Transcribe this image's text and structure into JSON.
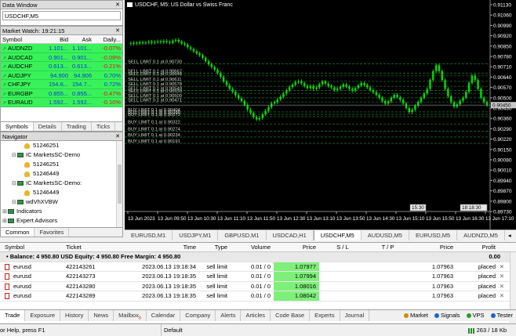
{
  "data_window": {
    "title": "Data Window",
    "symbol": "USDCHF,M5"
  },
  "market_watch": {
    "title": "Market Watch: 19:21:15",
    "headers": {
      "symbol": "Symbol",
      "bid": "Bid",
      "ask": "Ask",
      "daily": "Daily..."
    },
    "rows": [
      {
        "symbol": "AUDNZD",
        "bid": "1.101...",
        "ask": "1.101...",
        "daily": "-0.07%",
        "neg": true
      },
      {
        "symbol": "AUDCAD",
        "bid": "0.901...",
        "ask": "0.901...",
        "daily": "-0.09%",
        "neg": true
      },
      {
        "symbol": "AUDCHF",
        "bid": "0.613...",
        "ask": "0.613...",
        "daily": "-0.21%",
        "neg": true
      },
      {
        "symbol": "AUDJPY",
        "bid": "94.900",
        "ask": "94.906",
        "daily": "0.70%",
        "neg": false
      },
      {
        "symbol": "CHFJPY",
        "bid": "154.6...",
        "ask": "154.7...",
        "daily": "0.72%",
        "neg": false
      },
      {
        "symbol": "EURGBP",
        "bid": "0.855...",
        "ask": "0.855...",
        "daily": "-0.47%",
        "neg": true
      },
      {
        "symbol": "EURAUD",
        "bid": "1.592...",
        "ask": "1.592...",
        "daily": "-0.10%",
        "neg": true
      }
    ],
    "tabs": [
      "Symbols",
      "Details",
      "Trading",
      "Ticks"
    ]
  },
  "navigator": {
    "title": "Navigator",
    "items": [
      {
        "kind": "user",
        "label": "51246251",
        "indent": 30
      },
      {
        "kind": "server",
        "label": "IC MarketsSC-Demo",
        "indent": 14
      },
      {
        "kind": "user",
        "label": "51246251",
        "indent": 30
      },
      {
        "kind": "user",
        "label": "51246449",
        "indent": 30
      },
      {
        "kind": "server",
        "label": "IC MarketsSC-Demo:",
        "indent": 14
      },
      {
        "kind": "user",
        "label": "51246449",
        "indent": 30
      },
      {
        "kind": "server",
        "label": "wdVhXVBW",
        "indent": 14
      },
      {
        "kind": "folder",
        "label": "Indicators",
        "indent": 2
      },
      {
        "kind": "folder",
        "label": "Expert Advisors",
        "indent": 2
      }
    ],
    "tabs": [
      "Common",
      "Favorites"
    ]
  },
  "chart": {
    "title": "USDCHF, M5:  US Dollar vs Swiss Franc",
    "price_labels": [
      "0.91130",
      "0.91060",
      "0.90990",
      "0.90920",
      "0.90850",
      "0.90780",
      "0.90710",
      "0.90640",
      "0.90570",
      "0.90500",
      "0.90430",
      "0.90360",
      "0.90290",
      "0.90220",
      "0.90150",
      "0.90080",
      "0.90010",
      "0.89940",
      "0.89870",
      "0.89800",
      "0.89730"
    ],
    "current_price": "0.90450",
    "time_labels": [
      "13 Jun 2023",
      "13 Jun 09:50",
      "13 Jun 10:30",
      "13 Jun 11:10",
      "13 Jun 11:50",
      "13 Jun 12:30",
      "13 Jun 13:10",
      "13 Jun 13:50",
      "13 Jun 14:30",
      "13 Jun 15:10",
      "13 Jun 15:50",
      "13 Jun 16:30",
      "13 Jun 17:10"
    ],
    "time_boxes": [
      "15:30",
      "18:18:30"
    ],
    "orders": [
      "SELL LIMIT 0.1 at 0.90730",
      "SELL LIMIT 0.1 at 0.90667",
      "SELL LIMIT 0.1 at 0.90648",
      "SELL LIMIT 0.1 at 0.90611",
      "SELL LIMIT 0.1 at 0.90578",
      "SELL LIMIT 0.1 at 0.90549",
      "SELL LIMIT 0.1 at 0.90530",
      "SELL LIMIT 0.1 at 0.90500",
      "SELL LIMIT 0.1 at 0.90471",
      "BUY LIMIT 0.1 at 0.90404",
      "BUY LIMIT 0.1 at 0.90388",
      "BUY LIMIT 0.1 at 0.90372",
      "BUY LIMIT 0.1 at 0.90322",
      "BUY LIMIT 0.1 at 0.90274",
      "BUY LIMIT 0.1 at 0.90234",
      "BUY LIMIT 0.1 at 0.90191"
    ],
    "tabs": [
      "EURUSD,M1",
      "USDJPY,M1",
      "GBPUSD,M1",
      "USDCAD,H1",
      "USDCHF,M5",
      "AUDUSD,M5",
      "EURUSD,M5",
      "AUDNZD,M5"
    ],
    "active_tab": 4
  },
  "terminal": {
    "headers": [
      "Symbol",
      "Ticket",
      "Time",
      "Type",
      "Volume",
      "Price",
      "S / L",
      "T / P",
      "Price",
      "Profit"
    ],
    "balance": "Balance: 4 950.80 USD  Equity: 4 950.80  Free Margin: 4 950.80",
    "balance_profit": "0.00",
    "rows": [
      {
        "symbol": "eurusd",
        "ticket": "422143261",
        "time": "2023.06.13 19:18:34",
        "type": "sell limit",
        "volume": "0.01 / 0",
        "price": "1.07977",
        "sl": "",
        "tp": "",
        "cur": "1.07963",
        "state": "placed"
      },
      {
        "symbol": "eurusd",
        "ticket": "422143273",
        "time": "2023.06.13 19:18:35",
        "type": "sell limit",
        "volume": "0.01 / 0",
        "price": "1.07994",
        "sl": "",
        "tp": "",
        "cur": "1.07963",
        "state": "placed"
      },
      {
        "symbol": "eurusd",
        "ticket": "422143280",
        "time": "2023.06.13 19:18:35",
        "type": "sell limit",
        "volume": "0.01 / 0",
        "price": "1.08016",
        "sl": "",
        "tp": "",
        "cur": "1.07963",
        "state": "placed"
      },
      {
        "symbol": "eurusd",
        "ticket": "422143289",
        "time": "2023.06.13 19:18:35",
        "type": "sell limit",
        "volume": "0.01 / 0",
        "price": "1.08042",
        "sl": "",
        "tp": "",
        "cur": "1.07963",
        "state": "placed"
      }
    ],
    "tabs": [
      "Trade",
      "Exposure",
      "History",
      "News",
      "Mailbox",
      "Calendar",
      "Company",
      "Alerts",
      "Articles",
      "Code Base",
      "Experts",
      "Journal"
    ],
    "mailbox_badge": "8",
    "right_tools": [
      "Market",
      "Signals",
      "VPS",
      "Tester"
    ]
  },
  "status": {
    "help": "or Help, press F1",
    "profile": "Default",
    "traffic": "263 / 18 Kb"
  },
  "colors": {
    "chart_bg": "#000000",
    "candle": "#00e000",
    "grid": "#3a3a3a",
    "order_line": "#1e6e1e",
    "row_green": "#39f25a"
  }
}
